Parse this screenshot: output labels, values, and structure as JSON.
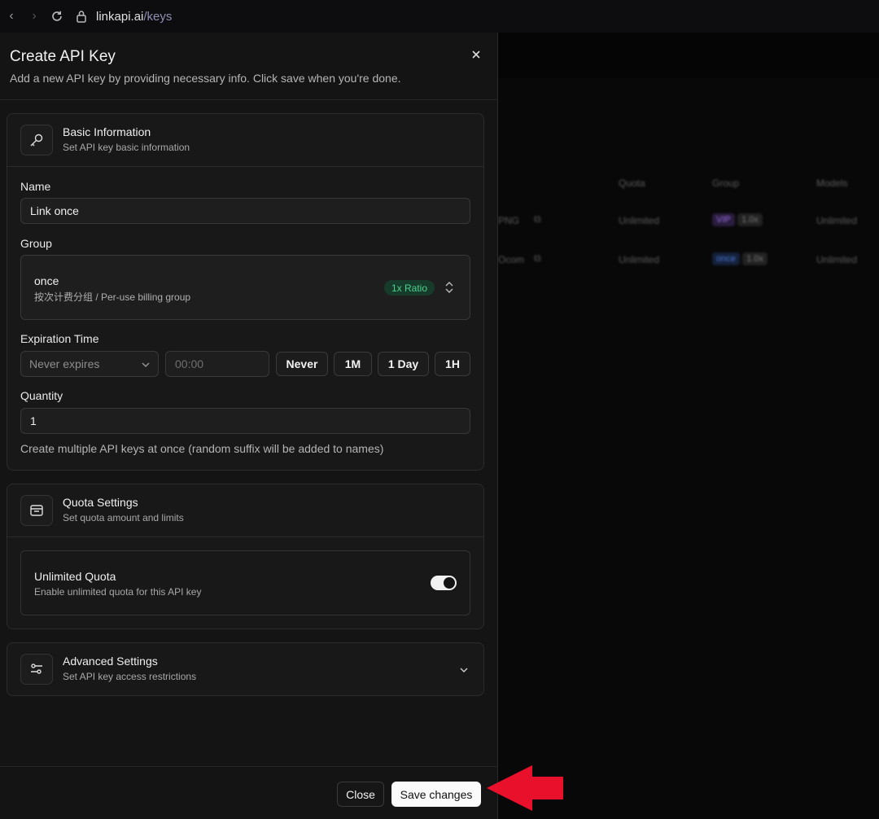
{
  "browser": {
    "url_host": "linkapi.ai",
    "url_path": "/keys"
  },
  "background_table": {
    "headers": [
      "Quota",
      "Group",
      "Models"
    ],
    "rows": [
      {
        "name": "PNG",
        "quota": "Unlimited",
        "group": "VIP",
        "group_extra": "1.0x",
        "models": "Unlimited"
      },
      {
        "name": "Ocom",
        "quota": "Unlimited",
        "group": "once",
        "group_extra": "1.0x",
        "models": "Unlimited"
      }
    ]
  },
  "dialog": {
    "title": "Create API Key",
    "description": "Add a new API key by providing necessary info. Click save when you're done.",
    "basic": {
      "title": "Basic Information",
      "subtitle": "Set API key basic information",
      "name_label": "Name",
      "name_value": "Link once",
      "group_label": "Group",
      "group_name": "once",
      "group_desc": "按次计费分组 / Per-use billing group",
      "group_ratio": "1x Ratio",
      "expiration_label": "Expiration Time",
      "expiration_select": "Never expires",
      "time_placeholder": "00:00",
      "quick_buttons": [
        "Never",
        "1M",
        "1 Day",
        "1H"
      ],
      "quantity_label": "Quantity",
      "quantity_value": "1",
      "quantity_help": "Create multiple API keys at once (random suffix will be added to names)"
    },
    "quota": {
      "title": "Quota Settings",
      "subtitle": "Set quota amount and limits",
      "unlimited_title": "Unlimited Quota",
      "unlimited_desc": "Enable unlimited quota for this API key",
      "unlimited_on": true
    },
    "advanced": {
      "title": "Advanced Settings",
      "subtitle": "Set API key access restrictions"
    },
    "footer": {
      "close_label": "Close",
      "save_label": "Save changes"
    }
  },
  "colors": {
    "accent_ratio": "#4fd08e",
    "annotation_arrow": "#e8102a"
  }
}
